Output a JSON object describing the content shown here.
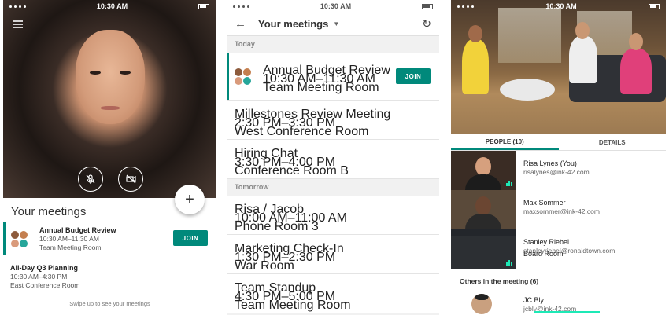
{
  "status": {
    "time": "10:30 AM"
  },
  "phone1": {
    "sheet_title": "Your meetings",
    "join_label": "JOIN",
    "meetings": [
      {
        "title": "Annual Budget Review",
        "time": "10:30 AM–11:30 AM",
        "room": "Team Meeting Room"
      },
      {
        "title": "All-Day Q3 Planning",
        "time": "10:30 AM–4:30 PM",
        "room": "East Conference Room"
      }
    ],
    "swipe_hint": "Swipe up to see your meetings"
  },
  "phone2": {
    "title": "Your meetings",
    "join_label": "JOIN",
    "sections": {
      "today": "Today",
      "tomorrow": "Tomorrow"
    },
    "today": [
      {
        "title": "Annual Budget Review",
        "time": "10:30 AM–11:30 AM",
        "room": "Team Meeting Room"
      },
      {
        "title": "Millestones Review Meeting",
        "time": "2:30 PM–3:30 PM",
        "room": "West Conference Room"
      },
      {
        "title": "Hiring Chat",
        "time": "3:30 PM–4:00 PM",
        "room": "Conference Room B"
      }
    ],
    "tomorrow": [
      {
        "title": "Risa / Jacob",
        "time": "10:00 AM–11:00 AM",
        "room": "Phone Room 3"
      },
      {
        "title": "Marketing Check-In",
        "time": "1:30 PM–2:30 PM",
        "room": "War Room"
      },
      {
        "title": "Team Standup",
        "time": "4:30 PM–5:00 PM",
        "room": "Team Meeting Room"
      }
    ]
  },
  "phone3": {
    "tabs": {
      "people": "PEOPLE (10)",
      "details": "DETAILS"
    },
    "people": [
      {
        "name": "Risa Lynes (You)",
        "email": "risalynes@ink-42.com"
      },
      {
        "name": "Max Sommer",
        "email": "maxsommer@ink-42.com"
      },
      {
        "name": "Stanley Riebel",
        "email": "stanleyriebel@ronaldtown.com"
      },
      {
        "name": "Board Room",
        "email": ""
      }
    ],
    "others_label": "Others in the meeting",
    "others_count": "(6)",
    "other_people": [
      {
        "name": "JC Bly",
        "email": "jcbly@ink-42.com"
      }
    ]
  },
  "colors": {
    "accent": "#00897b",
    "audio": "#1de9b6"
  },
  "icons": [
    "menu-icon",
    "mic-off-icon",
    "camera-off-icon",
    "add-icon",
    "back-arrow-icon",
    "dropdown-caret-icon",
    "refresh-icon",
    "audio-level-icon",
    "wifi-icon",
    "battery-icon"
  ]
}
